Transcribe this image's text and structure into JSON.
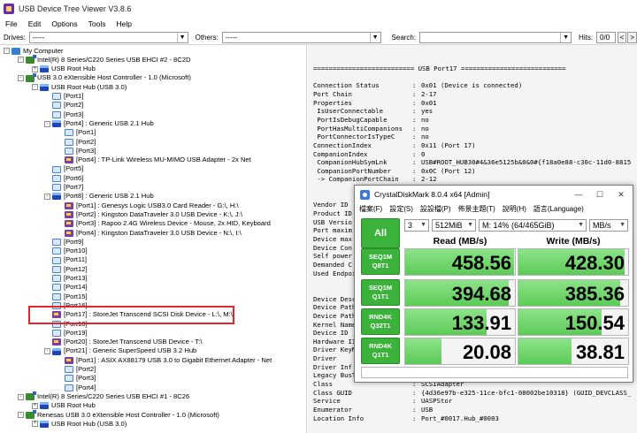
{
  "window": {
    "title": "USB Device Tree Viewer V3.8.6"
  },
  "menu": [
    "File",
    "Edit",
    "Options",
    "Tools",
    "Help"
  ],
  "toolbar": {
    "drives_label": "Drives:",
    "drives_value": "-----",
    "others_label": "Others:",
    "others_value": "-----",
    "search_label": "Search:",
    "search_value": "",
    "hits_label": "Hits:",
    "hits_value": "0/0",
    "prev_btn": "<",
    "next_btn": ">"
  },
  "tree": [
    {
      "level": 0,
      "icon": "pc",
      "exp": "-",
      "label": "My Computer"
    },
    {
      "level": 1,
      "icon": "hc",
      "exp": "-",
      "label": "Intel(R) 8 Series/C220 Series USB EHCI #2 - 8C2D"
    },
    {
      "level": 2,
      "icon": "hub",
      "exp": "+",
      "label": "USB Root Hub"
    },
    {
      "level": 1,
      "icon": "hc",
      "exp": "-",
      "label": "USB 3.0 eXtensible Host Controller - 1.0 (Microsoft)"
    },
    {
      "level": 2,
      "icon": "hub",
      "exp": "-",
      "label": "USB Root Hub (USB 3.0)"
    },
    {
      "level": 3,
      "icon": "port",
      "exp": "",
      "label": "[Port1]"
    },
    {
      "level": 3,
      "icon": "port",
      "exp": "",
      "label": "[Port2]"
    },
    {
      "level": 3,
      "icon": "port",
      "exp": "",
      "label": "[Port3]"
    },
    {
      "level": 3,
      "icon": "hub",
      "exp": "-",
      "label": "[Port4] : Generic USB 2.1 Hub"
    },
    {
      "level": 4,
      "icon": "port",
      "exp": "",
      "label": "[Port1]"
    },
    {
      "level": 4,
      "icon": "port",
      "exp": "",
      "label": "[Port2]"
    },
    {
      "level": 4,
      "icon": "port",
      "exp": "",
      "label": "[Port3]"
    },
    {
      "level": 4,
      "icon": "dev",
      "exp": "",
      "label": "[Port4] : TP-Link Wireless MU-MIMO USB Adapter - 2x Net"
    },
    {
      "level": 3,
      "icon": "port",
      "exp": "",
      "label": "[Port5]"
    },
    {
      "level": 3,
      "icon": "port",
      "exp": "",
      "label": "[Port6]"
    },
    {
      "level": 3,
      "icon": "port",
      "exp": "",
      "label": "[Port7]"
    },
    {
      "level": 3,
      "icon": "hub",
      "exp": "-",
      "label": "[Port8] : Generic USB 2.1 Hub"
    },
    {
      "level": 4,
      "icon": "dev",
      "exp": "",
      "label": "[Port1] : Genesys Logic USB3.0 Card Reader - G:\\, H:\\"
    },
    {
      "level": 4,
      "icon": "dev",
      "exp": "",
      "label": "[Port2] : Kingston DataTraveler 3.0 USB Device - K:\\, J:\\"
    },
    {
      "level": 4,
      "icon": "dev",
      "exp": "",
      "label": "[Port3] : Rapoo 2.4G Wireless Device - Mouse, 2x HID, Keyboard"
    },
    {
      "level": 4,
      "icon": "dev",
      "exp": "",
      "label": "[Port4] : Kingston DataTraveler 3.0 USB Device - N:\\, I:\\"
    },
    {
      "level": 3,
      "icon": "port",
      "exp": "",
      "label": "[Port9]"
    },
    {
      "level": 3,
      "icon": "port",
      "exp": "",
      "label": "[Port10]"
    },
    {
      "level": 3,
      "icon": "port",
      "exp": "",
      "label": "[Port11]"
    },
    {
      "level": 3,
      "icon": "port",
      "exp": "",
      "label": "[Port12]"
    },
    {
      "level": 3,
      "icon": "port",
      "exp": "",
      "label": "[Port13]"
    },
    {
      "level": 3,
      "icon": "port",
      "exp": "",
      "label": "[Port14]"
    },
    {
      "level": 3,
      "icon": "port",
      "exp": "",
      "label": "[Port15]"
    },
    {
      "level": 3,
      "icon": "port",
      "exp": "",
      "label": "[Port16]"
    },
    {
      "level": 3,
      "icon": "dev",
      "exp": "",
      "label": "[Port17] : StoreJet Transcend SCSI Disk Device - L:\\, M:\\"
    },
    {
      "level": 3,
      "icon": "port",
      "exp": "",
      "label": "[Port18]"
    },
    {
      "level": 3,
      "icon": "port",
      "exp": "",
      "label": "[Port19]"
    },
    {
      "level": 3,
      "icon": "dev",
      "exp": "",
      "label": "[Port20] : StoreJet Transcend USB Device - T:\\"
    },
    {
      "level": 3,
      "icon": "hub",
      "exp": "-",
      "label": "[Port21] : Generic SuperSpeed USB 3.2 Hub"
    },
    {
      "level": 4,
      "icon": "dev",
      "exp": "",
      "label": "[Port1] : ASIX AX88179 USB 3.0 to Gigabit Ethernet Adapter - Net"
    },
    {
      "level": 4,
      "icon": "port",
      "exp": "",
      "label": "[Port2]"
    },
    {
      "level": 4,
      "icon": "port",
      "exp": "",
      "label": "[Port3]"
    },
    {
      "level": 4,
      "icon": "port",
      "exp": "",
      "label": "[Port4]"
    },
    {
      "level": 1,
      "icon": "hc",
      "exp": "-",
      "label": "Intel(R) 8 Series/C220 Series USB EHCI #1 - 8C26"
    },
    {
      "level": 2,
      "icon": "hub",
      "exp": "+",
      "label": "USB Root Hub"
    },
    {
      "level": 1,
      "icon": "hc",
      "exp": "-",
      "label": "Renesas USB 3.0 eXtensible Host Controller - 1.0 (Microsoft)"
    },
    {
      "level": 2,
      "icon": "hub",
      "exp": "+",
      "label": "USB Root Hub (USB 3.0)"
    }
  ],
  "detail": [
    {
      "t": "h",
      "text": "========================== USB Port17 ==========================="
    },
    {
      "t": "blank"
    },
    {
      "t": "kv",
      "k": "Connection Status",
      "v": "0x01 (Device is connected)"
    },
    {
      "t": "kv",
      "k": "Port Chain",
      "v": "2-17"
    },
    {
      "t": "kv",
      "k": "Properties",
      "v": "0x01"
    },
    {
      "t": "kv",
      "k": " IsUserConnectable",
      "v": "yes"
    },
    {
      "t": "kv",
      "k": " PortIsDebugCapable",
      "v": "no"
    },
    {
      "t": "kv",
      "k": " PortHasMultiCompanions",
      "v": "no"
    },
    {
      "t": "kv",
      "k": " PortConnectorIsTypeC",
      "v": "no"
    },
    {
      "t": "kv",
      "k": "ConnectionIndex",
      "v": "0x11 (Port 17)"
    },
    {
      "t": "kv",
      "k": "CompanionIndex",
      "v": "0"
    },
    {
      "t": "kv",
      "k": " CompanionHubSymLnk",
      "v": "USB#ROOT_HUB30#4&36e5125b&0&0#{f18a0e88-c30c-11d0-8815"
    },
    {
      "t": "kv",
      "k": " CompanionPortNumber",
      "v": "0x0C (Port 12)"
    },
    {
      "t": "kv",
      "k": " -> CompanionPortChain",
      "v": "2-12"
    },
    {
      "t": "blank"
    },
    {
      "t": "h",
      "text": "                    ============"
    },
    {
      "t": "raw",
      "text": "Vendor ID"
    },
    {
      "t": "raw",
      "text": "Product ID"
    },
    {
      "t": "raw",
      "text": "USB Versio"
    },
    {
      "t": "raw",
      "text": "Port maxim"
    },
    {
      "t": "raw",
      "text": "Device max"
    },
    {
      "t": "raw",
      "text": "Device Con"
    },
    {
      "t": "raw",
      "text": "Self power"
    },
    {
      "t": "raw",
      "text": "Demanded C"
    },
    {
      "t": "raw",
      "text": "Used Endpoi"
    },
    {
      "t": "blank"
    },
    {
      "t": "h",
      "text": "           ++"
    },
    {
      "t": "raw",
      "text": "Device Desc"
    },
    {
      "t": "raw",
      "text": "Device Path"
    },
    {
      "t": "raw",
      "text": "Device Path"
    },
    {
      "t": "raw",
      "text": "Kernel Name"
    },
    {
      "t": "raw",
      "text": "Device ID"
    },
    {
      "t": "raw",
      "text": "Hardware II"
    },
    {
      "t": "raw",
      "text": "Driver KeyN"
    },
    {
      "t": "raw",
      "text": "Driver"
    },
    {
      "t": "raw",
      "text": "Driver Inf"
    },
    {
      "t": "kv",
      "k": "Legacy BusType",
      "v": "PNPBus"
    },
    {
      "t": "kv",
      "k": "Class",
      "v": "SCSIAdapter"
    },
    {
      "t": "kv",
      "k": "Class GUID",
      "v": "{4d36e97b-e325-11ce-bfc1-08002be10318} (GUID_DEVCLASS_"
    },
    {
      "t": "kv",
      "k": "Service",
      "v": "UASPStor"
    },
    {
      "t": "kv",
      "k": "Enumerator",
      "v": "USB"
    },
    {
      "t": "kv",
      "k": "Location Info",
      "v": "Port_#0017.Hub_#0003"
    }
  ],
  "cdm": {
    "title": "CrystalDiskMark 8.0.4 x64 [Admin]",
    "min_btn": "—",
    "max_btn": "☐",
    "close_btn": "✕",
    "menu": [
      "檔案(F)",
      "設定(S)",
      "設設檔(P)",
      "佈景主題(T)",
      "說明(H)",
      "語言(Language)"
    ],
    "all_btn": "All",
    "count": "3",
    "size": "512MiB",
    "drive": "M: 14% (64/465GiB)",
    "unit": "MB/s",
    "read_head": "Read (MB/s)",
    "write_head": "Write (MB/s)",
    "comment": "",
    "rows": [
      {
        "name1": "SEQ1M",
        "name2": "Q8T1",
        "read": "458.56",
        "write": "428.30",
        "read_frac": 0.99,
        "write_frac": 0.97
      },
      {
        "name1": "SEQ1M",
        "name2": "Q1T1",
        "read": "394.68",
        "write": "385.36",
        "read_frac": 0.94,
        "write_frac": 0.93
      },
      {
        "name1": "RND4K",
        "name2": "Q32T1",
        "read": "133.91",
        "write": "150.54",
        "read_frac": 0.74,
        "write_frac": 0.76
      },
      {
        "name1": "RND4K",
        "name2": "Q1T1",
        "read": "20.08",
        "write": "38.81",
        "read_frac": 0.33,
        "write_frac": 0.48
      }
    ]
  },
  "colors": {
    "accent_green": "#3bb33b",
    "highlight": "#e3262b"
  }
}
